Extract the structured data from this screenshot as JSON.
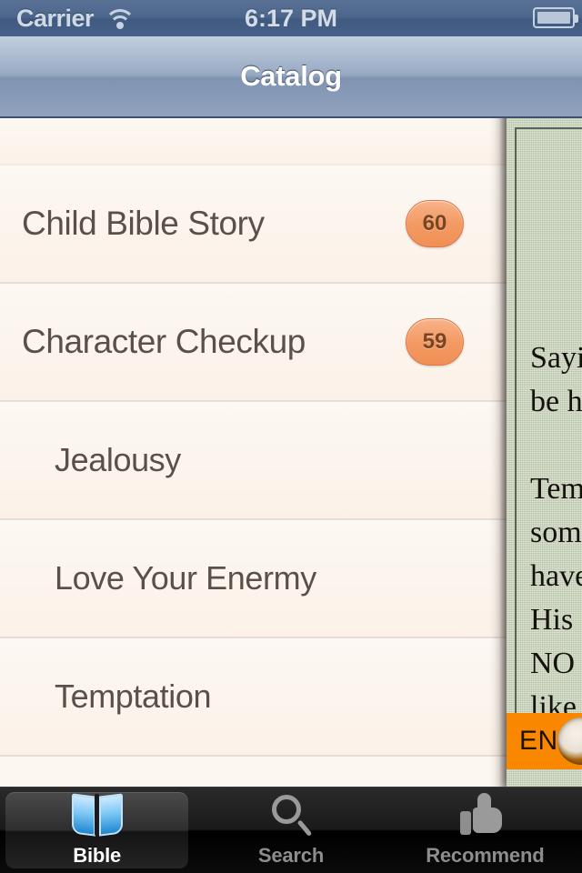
{
  "status_bar": {
    "carrier": "Carrier",
    "wifi_icon": "wifi-icon",
    "time": "6:17 PM",
    "battery_icon": "battery-icon"
  },
  "nav_bar": {
    "title": "Catalog"
  },
  "catalog_list": {
    "rows": [
      {
        "label": "",
        "level": 0,
        "badge": "",
        "partial": true
      },
      {
        "label": "Child Bible Story",
        "level": 1,
        "badge": "60",
        "partial": false
      },
      {
        "label": "Character Checkup",
        "level": 1,
        "badge": "59",
        "partial": false
      },
      {
        "label": "Jealousy",
        "level": 2,
        "badge": "",
        "partial": false
      },
      {
        "label": "Love Your Enermy",
        "level": 2,
        "badge": "",
        "partial": false
      },
      {
        "label": "Temptation",
        "level": 2,
        "badge": "",
        "partial": false
      }
    ]
  },
  "reader_panel": {
    "menu_icon": "hamburger-menu-icon",
    "body_text": "Sayi\nbe h\n\nTem\nsom\nhave\nHis\nNO\nlike\nPerh",
    "language_label": "EN"
  },
  "tab_bar": {
    "tabs": [
      {
        "label": "Bible",
        "icon": "book-icon",
        "selected": true
      },
      {
        "label": "Search",
        "icon": "search-icon",
        "selected": false
      },
      {
        "label": "Recommend",
        "icon": "thumbs-up-icon",
        "selected": false
      }
    ]
  },
  "colors": {
    "accent_badge": "#f39a63",
    "badge_text": "#7a4525",
    "navbar_blue": "#8094b2",
    "statusbar_blue": "#47608a",
    "list_bg": "#fdf7f1",
    "reader_bg": "#cfd9c2",
    "language_bar": "#f98800",
    "tabbar_bg": "#000000"
  }
}
